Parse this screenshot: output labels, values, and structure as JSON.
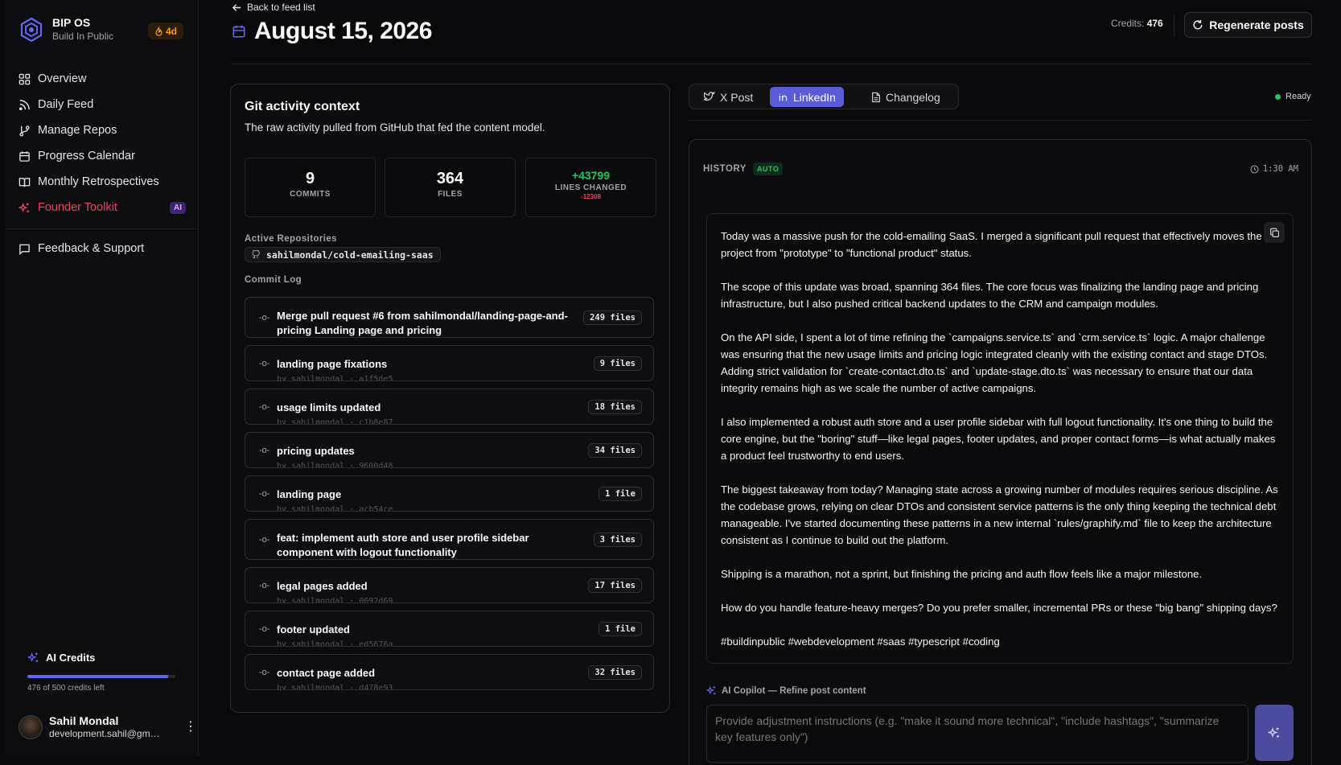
{
  "brand": {
    "title": "BIP OS",
    "subtitle": "Build In Public",
    "streak": "4d"
  },
  "nav": {
    "items": [
      {
        "label": "Overview",
        "icon": "grid-icon"
      },
      {
        "label": "Daily Feed",
        "icon": "rss-icon"
      },
      {
        "label": "Manage Repos",
        "icon": "git-branch-icon"
      },
      {
        "label": "Progress Calendar",
        "icon": "calendar-icon"
      },
      {
        "label": "Monthly Retrospectives",
        "icon": "book-icon"
      },
      {
        "label": "Founder Toolkit",
        "icon": "sparkles-icon",
        "badge": "AI"
      }
    ],
    "feedback": "Feedback & Support"
  },
  "credits": {
    "title": "AI Credits",
    "used": 476,
    "total": 500,
    "fraction": 0.952,
    "note": "476 of 500 credits left"
  },
  "user": {
    "name": "Sahil Mondal",
    "email": "development.sahil@gmail.com"
  },
  "header": {
    "back": "Back to feed list",
    "date": "August 15, 2026",
    "credits_label": "Credits:",
    "credits_value": "476",
    "regenerate": "Regenerate posts"
  },
  "git": {
    "title": "Git activity context",
    "description": "The raw activity pulled from GitHub that fed the content model.",
    "stats": {
      "commits": "9",
      "commits_label": "COMMITS",
      "files": "364",
      "files_label": "FILES",
      "added": "+43799",
      "lines_label": "LINES CHANGED",
      "removed": "-12308"
    },
    "repos_label": "Active Repositories",
    "repo": "sahilmondal/cold-emailing-saas",
    "log_label": "Commit Log",
    "commits": [
      {
        "msg": "Merge pull request #6 from sahilmondal/landing-page-and-pricing Landing page and pricing",
        "files": "249 files",
        "meta": ""
      },
      {
        "msg": "landing page fixations",
        "files": "9 files",
        "meta": "by sahilmondal · a1f5de5"
      },
      {
        "msg": "usage limits updated",
        "files": "18 files",
        "meta": "by sahilmondal · c1b8e87"
      },
      {
        "msg": "pricing updates",
        "files": "34 files",
        "meta": "by sahilmondal · 9600d48"
      },
      {
        "msg": "landing page",
        "files": "1 file",
        "meta": "by sahilmondal · acb54ce"
      },
      {
        "msg": "feat: implement auth store and user profile sidebar component with logout functionality",
        "files": "3 files",
        "meta": ""
      },
      {
        "msg": "legal pages added",
        "files": "17 files",
        "meta": "by sahilmondal · 0692d69"
      },
      {
        "msg": "footer updated",
        "files": "1 file",
        "meta": "by sahilmondal · ed5676a"
      },
      {
        "msg": "contact page added",
        "files": "32 files",
        "meta": "by sahilmondal · d478e93"
      }
    ]
  },
  "tabs": [
    {
      "label": "X Post",
      "icon": "x-bird-icon"
    },
    {
      "label": "LinkedIn",
      "icon": "linkedin-icon"
    },
    {
      "label": "Changelog",
      "icon": "file-text-icon"
    }
  ],
  "status": "Ready",
  "history": {
    "label": "HISTORY",
    "badge": "AUTO",
    "time": "1:30 AM"
  },
  "post": [
    "Today was a massive push for the cold-emailing SaaS. I merged a significant pull request that effectively moves the project from \"prototype\" to \"functional product\" status.",
    "The scope of this update was broad, spanning 364 files. The core focus was finalizing the landing page and pricing infrastructure, but I also pushed critical backend updates to the CRM and campaign modules.",
    "On the API side, I spent a lot of time refining the `campaigns.service.ts` and `crm.service.ts` logic. A major challenge was ensuring that the new usage limits and pricing logic integrated cleanly with the existing contact and stage DTOs. Adding strict validation for `create-contact.dto.ts` and `update-stage.dto.ts` was necessary to ensure that our data integrity remains high as we scale the number of active campaigns.",
    "I also implemented a robust auth store and a user profile sidebar with full logout functionality. It's one thing to build the core engine, but the \"boring\" stuff—like legal pages, footer updates, and proper contact forms—is what actually makes a product feel trustworthy to end users.",
    "The biggest takeaway from today? Managing state across a growing number of modules requires serious discipline. As the codebase grows, relying on clear DTOs and consistent service patterns is the only thing keeping the technical debt manageable. I've started documenting these patterns in a new internal `rules/graphify.md` file to keep the architecture consistent as I continue to build out the platform.",
    "Shipping is a marathon, not a sprint, but finishing the pricing and auth flow feels like a major milestone.",
    "How do you handle feature-heavy merges? Do you prefer smaller, incremental PRs or these \"big bang\" shipping days?",
    "#buildinpublic #webdevelopment #saas #typescript #coding"
  ],
  "copilot": {
    "label": "AI Copilot — Refine post content",
    "placeholder": "Provide adjustment instructions (e.g. \"make it sound more technical\", \"include hashtags\", \"summarize key features only\")"
  },
  "colors": {
    "accent": "#5b5bd6",
    "rose": "#f43f5e",
    "green": "#22c55e",
    "amber": "#f59e0b"
  }
}
